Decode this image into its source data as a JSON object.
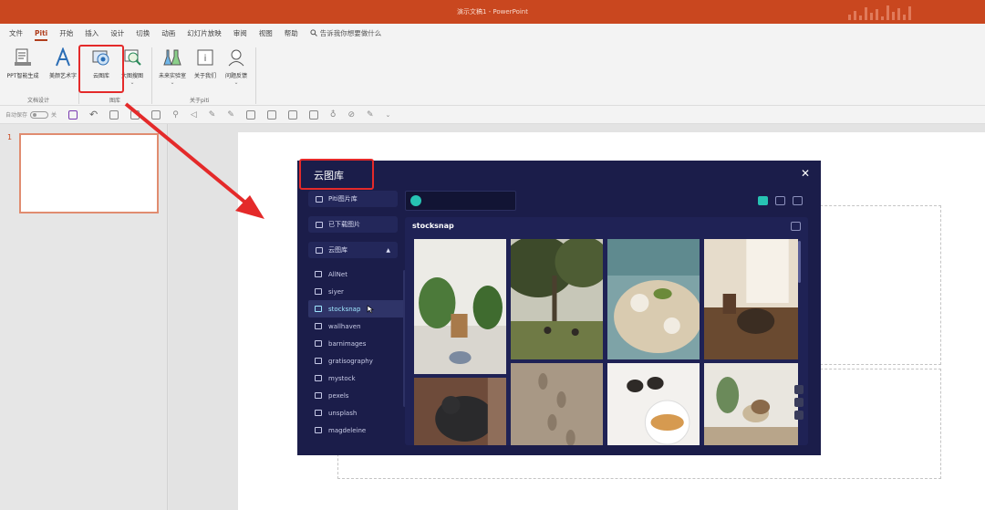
{
  "window": {
    "title": "演示文稿1 - PowerPoint"
  },
  "menu": {
    "tabs": [
      "文件",
      "Piti",
      "开始",
      "插入",
      "设计",
      "切换",
      "动画",
      "幻灯片放映",
      "审阅",
      "视图",
      "帮助"
    ],
    "active_tab": "Piti",
    "tell_me": "告诉我你想要做什么"
  },
  "ribbon": {
    "buttons": [
      {
        "label": "PPT智能生成",
        "icon": "document-gen-icon"
      },
      {
        "label": "美颜艺术字",
        "icon": "art-text-icon"
      },
      {
        "label": "云图库",
        "icon": "cloud-gallery-icon"
      },
      {
        "label": "大图搜图",
        "icon": "image-search-icon"
      },
      {
        "label": "未来实验室",
        "icon": "lab-flask-icon"
      },
      {
        "label": "关于我们",
        "icon": "about-us-icon"
      },
      {
        "label": "问题反馈",
        "icon": "feedback-icon"
      }
    ],
    "groups": [
      "文档设计",
      "图库",
      "关于piti"
    ]
  },
  "qat": {
    "autosave_label": "自动保存",
    "autosave_state": "关"
  },
  "slides": {
    "current_number": "1"
  },
  "dialog": {
    "title": "云图库",
    "close_label": "✕",
    "nav": [
      {
        "label": "Piti图片库"
      },
      {
        "label": "已下载图片"
      },
      {
        "label": "云图库",
        "chevron": "▲"
      }
    ],
    "sources": [
      "AllNet",
      "siyer",
      "stocksnap",
      "wallhaven",
      "barnimages",
      "gratisography",
      "mystock",
      "pexels",
      "unsplash",
      "magdeleine"
    ],
    "selected_source": "stocksnap",
    "search_placeholder": "",
    "gallery_title": "stocksnap"
  },
  "colors": {
    "title_bar": "#c9471f",
    "accent": "#b03d1c",
    "dialog_bg": "#1b1d4a",
    "highlight": "#27c3b3",
    "annotation": "#e42a2a"
  }
}
